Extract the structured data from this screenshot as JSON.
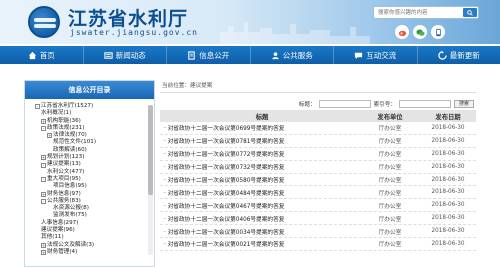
{
  "header": {
    "site_title": "江苏省水利厅",
    "site_url": "jswater.jiangsu.gov.cn",
    "search_placeholder": "搜索你感兴趣的内容",
    "icons": [
      "weibo-icon",
      "wechat-icon",
      "app-icon"
    ]
  },
  "nav": {
    "items": [
      {
        "label": "首页",
        "icon": "home-icon"
      },
      {
        "label": "新闻动态",
        "icon": "news-icon"
      },
      {
        "label": "信息公开",
        "icon": "info-icon"
      },
      {
        "label": "公共服务",
        "icon": "service-icon"
      },
      {
        "label": "互动交流",
        "icon": "chat-icon"
      },
      {
        "label": "最新更新",
        "icon": "refresh-icon"
      }
    ]
  },
  "sidebar": {
    "title": "信息公开目录",
    "tree": [
      {
        "label": "江苏省水利厅(1527)",
        "indent": 0,
        "toggle": "-",
        "hl": false
      },
      {
        "label": "水利概况(1)",
        "indent": 1,
        "toggle": "",
        "hl": false
      },
      {
        "label": "机构职能(36)",
        "indent": 1,
        "toggle": "+",
        "hl": false
      },
      {
        "label": "政策法规(231)",
        "indent": 1,
        "toggle": "-",
        "hl": false
      },
      {
        "label": "法律法规(70)",
        "indent": 2,
        "toggle": "+",
        "hl": false
      },
      {
        "label": "规范性文件(101)",
        "indent": 3,
        "toggle": "",
        "hl": false
      },
      {
        "label": "政策解读(60)",
        "indent": 3,
        "toggle": "",
        "hl": false
      },
      {
        "label": "规划计划(123)",
        "indent": 1,
        "toggle": "+",
        "hl": false
      },
      {
        "label": "建议提案(13)",
        "indent": 1,
        "toggle": "-",
        "hl": false
      },
      {
        "label": "水利公文(477)",
        "indent": 2,
        "toggle": "",
        "hl": false
      },
      {
        "label": "重大项目(95)",
        "indent": 1,
        "toggle": "-",
        "hl": false
      },
      {
        "label": "项目信息(95)",
        "indent": 3,
        "toggle": "",
        "hl": false
      },
      {
        "label": "财务信息(97)",
        "indent": 1,
        "toggle": "+",
        "hl": false
      },
      {
        "label": "公共服务(83)",
        "indent": 1,
        "toggle": "-",
        "hl": false
      },
      {
        "label": "水资源公报(8)",
        "indent": 3,
        "toggle": "",
        "hl": false
      },
      {
        "label": "监测发布(75)",
        "indent": 3,
        "toggle": "",
        "hl": false
      },
      {
        "label": "人事信息(297)",
        "indent": 1,
        "toggle": "",
        "hl": false
      },
      {
        "label": "建议提案(96)",
        "indent": 1,
        "toggle": "",
        "hl": false
      },
      {
        "label": "其他(11)",
        "indent": 1,
        "toggle": "",
        "hl": false
      },
      {
        "label": "法规公文及解读(3)",
        "indent": 1,
        "toggle": "+",
        "hl": false
      },
      {
        "label": "财务管理(4)",
        "indent": 1,
        "toggle": "+",
        "hl": false
      }
    ]
  },
  "main": {
    "breadcrumb": "当前位置：建议提案",
    "filter": {
      "title_label": "标题：",
      "number_label": "索引号：",
      "search_btn": "搜索"
    },
    "columns": {
      "title": "标题",
      "unit": "发布单位",
      "date": "发布日期"
    },
    "rows": [
      {
        "title": "· 对省政协十二届一次会议第0699号提案的答复",
        "unit": "厅办公室",
        "date": "2018-06-30"
      },
      {
        "title": "· 对省政协十二届一次会议第0781号提案的答复",
        "unit": "厅办公室",
        "date": "2018-06-30"
      },
      {
        "title": "· 对省政协十二届一次会议第0772号提案的答复",
        "unit": "厅办公室",
        "date": "2018-06-30"
      },
      {
        "title": "· 对省政协十二届一次会议第0732号提案的答复",
        "unit": "厅办公室",
        "date": "2018-06-30"
      },
      {
        "title": "· 对省政协十二届一次会议第0580号提案的答复",
        "unit": "厅办公室",
        "date": "2018-06-30"
      },
      {
        "title": "· 对省政协十二届一次会议第0484号提案的答复",
        "unit": "厅办公室",
        "date": "2018-06-30"
      },
      {
        "title": "· 对省政协十二届一次会议第0467号提案的答复",
        "unit": "厅办公室",
        "date": "2018-06-30"
      },
      {
        "title": "· 对省政协十二届一次会议第0406号提案的答复",
        "unit": "厅办公室",
        "date": "2018-06-30"
      },
      {
        "title": "· 对省政协十二届一次会议第0034号提案的答复",
        "unit": "厅办公室",
        "date": "2018-06-30"
      },
      {
        "title": "· 对省政协十二届一次会议第0021号提案的答复",
        "unit": "厅办公室",
        "date": "2018-06-30"
      }
    ]
  },
  "colors": {
    "nav_bg": "#1469b8",
    "title_blue": "#0d4f91",
    "tree_highlight": "#0e5aa7"
  }
}
